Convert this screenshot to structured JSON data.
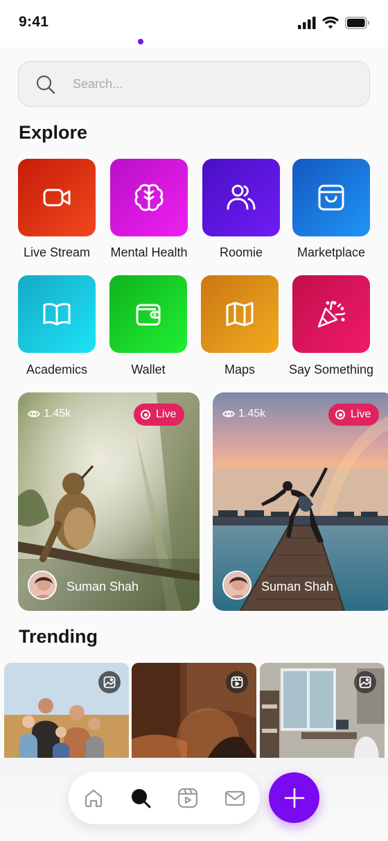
{
  "status_bar": {
    "time": "9:41"
  },
  "search": {
    "placeholder": "Search..."
  },
  "explore": {
    "title": "Explore",
    "items": [
      {
        "label": "Live Stream",
        "icon": "video-camera-icon",
        "color": "#e83a1e"
      },
      {
        "label": "Mental Health",
        "icon": "brain-icon",
        "color": "#d617e3"
      },
      {
        "label": "Roomie",
        "icon": "users-icon",
        "color": "#5a12e0"
      },
      {
        "label": "Marketplace",
        "icon": "shopping-bag-icon",
        "color": "#1a74dc"
      },
      {
        "label": "Academics",
        "icon": "open-book-icon",
        "color": "#17c2dc"
      },
      {
        "label": "Wallet",
        "icon": "wallet-icon",
        "color": "#18d22c"
      },
      {
        "label": "Maps",
        "icon": "map-icon",
        "color": "#e49a17"
      },
      {
        "label": "Say Something",
        "icon": "party-popper-icon",
        "color": "#d61259"
      }
    ]
  },
  "live_streams": [
    {
      "viewers": "1.45k",
      "badge": "Live",
      "streamer": "Suman Shah"
    },
    {
      "viewers": "1.45k",
      "badge": "Live",
      "streamer": "Suman Shah"
    }
  ],
  "trending": {
    "title": "Trending",
    "items": [
      {
        "type_icon": "image-icon"
      },
      {
        "type_icon": "reel-icon"
      },
      {
        "type_icon": "image-icon"
      }
    ]
  },
  "bottom_nav": {
    "items": [
      "home-icon",
      "search-icon",
      "reels-icon",
      "mail-icon"
    ],
    "active": "search-icon",
    "accent": "#7a0af0"
  }
}
